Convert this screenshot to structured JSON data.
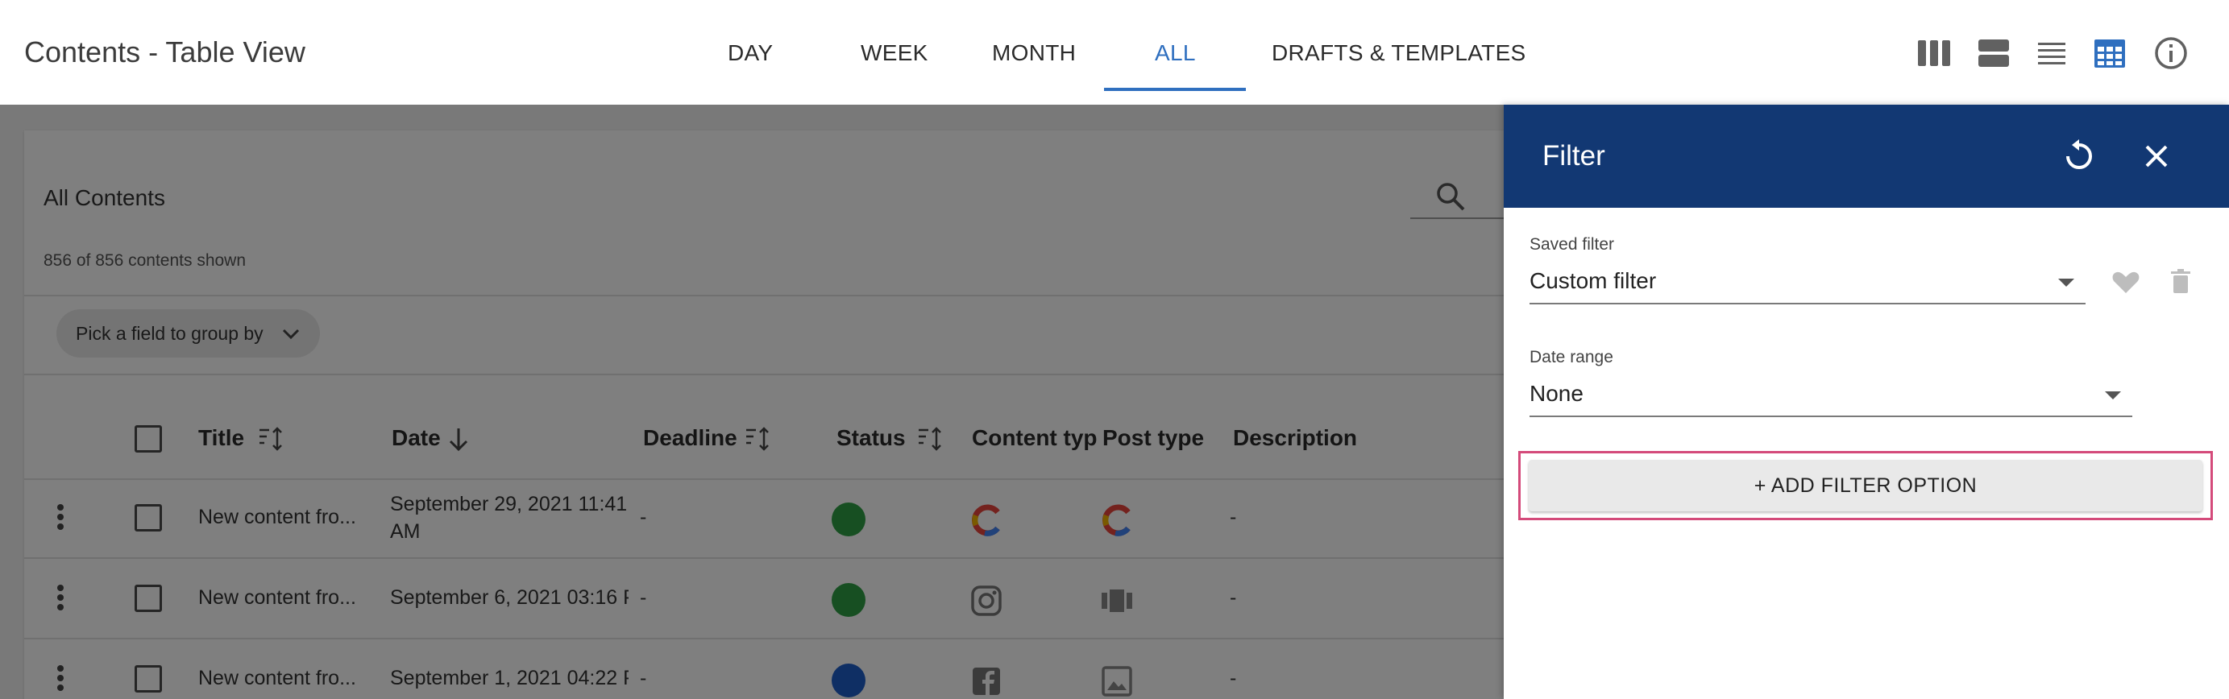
{
  "header": {
    "title": "Contents - Table View",
    "tabs": [
      "DAY",
      "WEEK",
      "MONTH",
      "ALL",
      "DRAFTS & TEMPLATES"
    ],
    "active_tab": "ALL",
    "view_icons": [
      "columns-view-icon",
      "rows-view-icon",
      "list-view-icon",
      "table-view-icon",
      "info-icon"
    ]
  },
  "card": {
    "title": "All Contents",
    "count": "856 of 856 contents shown",
    "group_by": "Pick a field to group by"
  },
  "table": {
    "columns": [
      "Title",
      "Date",
      "Deadline",
      "Status",
      "Content typ",
      "Post type",
      "Description"
    ],
    "rows": [
      {
        "title": "New content fro...",
        "date_line1": "September 29, 2021 11:41",
        "date_line2": "AM",
        "deadline": "-",
        "status_color": "#2f9e44",
        "content_type": "brand-logo-icon",
        "post_type": "brand-logo-icon",
        "description": "-"
      },
      {
        "title": "New content fro...",
        "date_line1": "September 6, 2021 03:16 P",
        "date_line2": "",
        "deadline": "-",
        "status_color": "#2f9e44",
        "content_type": "instagram-icon",
        "post_type": "carousel-icon",
        "description": "-"
      },
      {
        "title": "New content fro...",
        "date_line1": "September 1, 2021 04:22 P",
        "date_line2": "",
        "deadline": "-",
        "status_color": "#1f5fc8",
        "content_type": "facebook-icon",
        "post_type": "image-icon",
        "description": "-"
      }
    ]
  },
  "filter": {
    "title": "Filter",
    "saved_filter_label": "Saved filter",
    "saved_filter_value": "Custom filter",
    "date_range_label": "Date range",
    "date_range_value": "None",
    "add_button": "+ ADD FILTER OPTION"
  },
  "colors": {
    "accent": "#2f6fbf",
    "panel_header": "#123873",
    "highlight_border": "#d44a7a"
  }
}
